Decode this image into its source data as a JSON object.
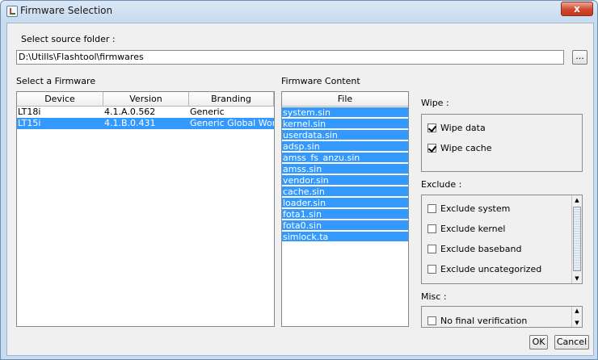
{
  "window": {
    "title": "Firmware Selection",
    "close_label": "x"
  },
  "source": {
    "label": "Select source folder :",
    "path": "D:\\Utills\\Flashtool\\firmwares",
    "browse_label": "..."
  },
  "firmware": {
    "label": "Select a Firmware",
    "columns": [
      "Device",
      "Version",
      "Branding"
    ],
    "rows": [
      {
        "device": "LT18i",
        "version": "4.1.A.0.562",
        "branding": "Generic",
        "selected": false
      },
      {
        "device": "LT15i",
        "version": "4.1.B.0.431",
        "branding": "Generic Global World",
        "selected": true
      }
    ]
  },
  "content": {
    "label": "Firmware Content",
    "header": "File",
    "files": [
      "system.sin",
      "kernel.sin",
      "userdata.sin",
      "adsp.sin",
      "amss_fs_anzu.sin",
      "amss.sin",
      "vendor.sin",
      "cache.sin",
      "loader.sin",
      "fota1.sin",
      "fota0.sin",
      "simlock.ta"
    ]
  },
  "wipe": {
    "label": "Wipe :",
    "options": [
      {
        "label": "Wipe data",
        "checked": true
      },
      {
        "label": "Wipe cache",
        "checked": true
      }
    ]
  },
  "exclude": {
    "label": "Exclude :",
    "options": [
      {
        "label": "Exclude system",
        "checked": false
      },
      {
        "label": "Exclude kernel",
        "checked": false
      },
      {
        "label": "Exclude baseband",
        "checked": false
      },
      {
        "label": "Exclude uncategorized",
        "checked": false
      }
    ]
  },
  "misc": {
    "label": "Misc :",
    "options": [
      {
        "label": "No final verification",
        "checked": false
      }
    ]
  },
  "buttons": {
    "ok": "OK",
    "cancel": "Cancel"
  },
  "colors": {
    "selection": "#3399ff",
    "titlebar": "#c9dbef",
    "close": "#d1462b"
  }
}
